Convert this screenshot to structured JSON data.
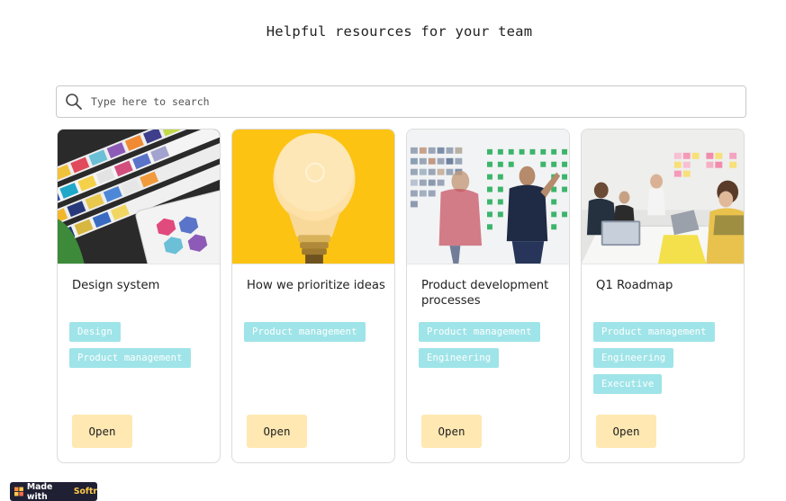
{
  "page": {
    "title": "Helpful resources for your team"
  },
  "search": {
    "placeholder": "Type here to search",
    "value": ""
  },
  "cards": [
    {
      "title": "Design system",
      "tags": [
        "Design",
        "Product management"
      ],
      "button": "Open"
    },
    {
      "title": "How we prioritize ideas",
      "tags": [
        "Product management"
      ],
      "button": "Open"
    },
    {
      "title": "Product development processes",
      "tags": [
        "Product management",
        "Engineering"
      ],
      "button": "Open"
    },
    {
      "title": "Q1 Roadmap",
      "tags": [
        "Product management",
        "Engineering",
        "Executive"
      ],
      "button": "Open"
    }
  ],
  "footer": {
    "made_with": "Made with",
    "brand": "Softr"
  },
  "colors": {
    "tag_bg": "#9fe4e8",
    "button_bg": "#ffe8b2",
    "badge_bg": "#1f2033",
    "brand": "#ffc94a"
  },
  "icons": {
    "search": "search-icon",
    "logo": "softr-logo-icon"
  }
}
